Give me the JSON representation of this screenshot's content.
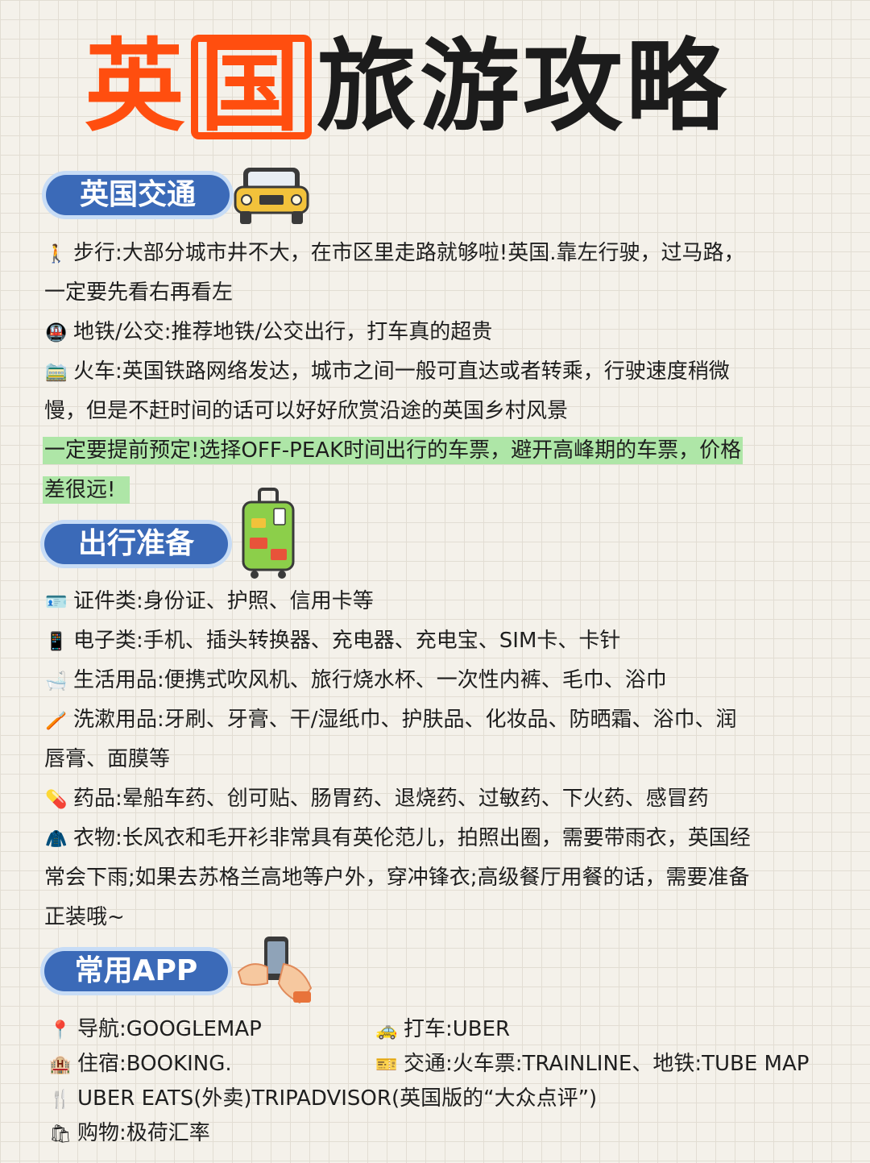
{
  "title": {
    "part1": "英",
    "part2": "国",
    "part3": "旅游攻略"
  },
  "sections": {
    "transport": {
      "heading": "英国交通",
      "walk": {
        "label": "步行:",
        "text1": "大部分城市井不大，在市区里走路就够啦!英国.靠左行驶，过马路，",
        "text2": "一定要先看右再看左"
      },
      "metro": {
        "label": "地铁/公交:",
        "text": "推荐地铁/公交出行，打车真的超贵"
      },
      "train": {
        "label": "火车:",
        "text1": "英国铁路网络发达，城市之间一般可直达或者转乘，行驶速度稍微",
        "text2": "慢，但是不赶时间的话可以好好欣赏沿途的英国乡村风景"
      },
      "highlight": {
        "text1": "一定要提前预定!选择OFF-PEAK时间出行的车票，避开高峰期的车票，价格",
        "text2": "差很远!"
      }
    },
    "prep": {
      "heading": "出行准备",
      "docs": {
        "label": "证件类:",
        "text": "身份证、护照、信用卡等"
      },
      "electronics": {
        "label": "电子类:",
        "text": "手机、插头转换器、充电器、充电宝、SIM卡、卡针"
      },
      "daily": {
        "label": "生活用品:",
        "text": "便携式吹风机、旅行烧水杯、一次性内裤、毛巾、浴巾"
      },
      "toiletries": {
        "label": "洗漱用品:",
        "text1": "牙刷、牙膏、干/湿纸巾、护肤品、化妆品、防晒霜、浴巾、润",
        "text2": "唇膏、面膜等"
      },
      "medicine": {
        "label": "药品:",
        "text": "晕船车药、创可贴、肠胃药、退烧药、过敏药、下火药、感冒药"
      },
      "clothes": {
        "label": "衣物:",
        "text1": "长风衣和毛开衫非常具有英伦范儿，拍照出圈，需要带雨衣，英国经",
        "text2": "常会下雨;如果去苏格兰高地等户外，穿冲锋衣;高级餐厅用餐的话，需要准备",
        "text3": "正装哦~"
      }
    },
    "apps": {
      "heading": "常用APP",
      "nav": "导航:GOOGLEMAP",
      "taxi": "打车:UBER",
      "stay": "住宿:BOOKING.",
      "transit": "交通:火车票:TRAINLINE、地铁:TUBE MAP",
      "eats": "UBER EATS(外卖)TRIPADVISOR(英国版的“大众点评”)",
      "shop": "购物:极荷汇率"
    }
  },
  "icons": {
    "walk": "🚶",
    "metro": "🚇",
    "train": "🚞",
    "docs": "🪪",
    "electronics": "📱",
    "daily": "🛁",
    "toiletries": "🪥",
    "medicine": "💊",
    "clothes": "🧥",
    "nav": "📍",
    "taxi": "🚕",
    "stay": "🏨",
    "transit": "🎫",
    "eats": "🍴",
    "shop": "🛍"
  },
  "colors": {
    "accent": "#ff4e0f",
    "pill": "#3b6ab8",
    "highlight": "#aee6a7"
  }
}
